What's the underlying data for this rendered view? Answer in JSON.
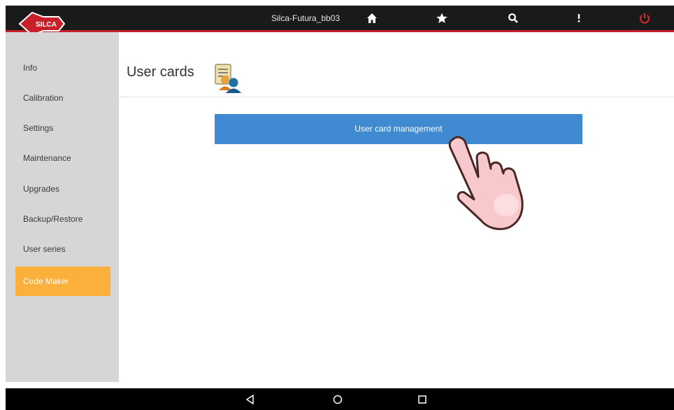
{
  "topbar": {
    "device_name": "Silca-Futura_bb03",
    "logo_text": "SILCA",
    "icons": [
      "home-icon",
      "star-icon",
      "search-icon",
      "more-vertical-icon",
      "power-icon"
    ],
    "power_color": "#e8262c"
  },
  "sidebar": {
    "items": [
      {
        "label": "Info"
      },
      {
        "label": "Calibration"
      },
      {
        "label": "Settings"
      },
      {
        "label": "Maintenance"
      },
      {
        "label": "Upgrades"
      },
      {
        "label": "Backup/Restore"
      },
      {
        "label": "User series"
      },
      {
        "label": "Code Maker",
        "active": true
      }
    ],
    "active_color": "#fbb03b"
  },
  "main": {
    "title": "User cards",
    "management_button": "User card management",
    "button_color": "#3f8ad0"
  },
  "navbar": {
    "buttons": [
      "back-icon",
      "home-circle-icon",
      "recents-icon"
    ]
  }
}
